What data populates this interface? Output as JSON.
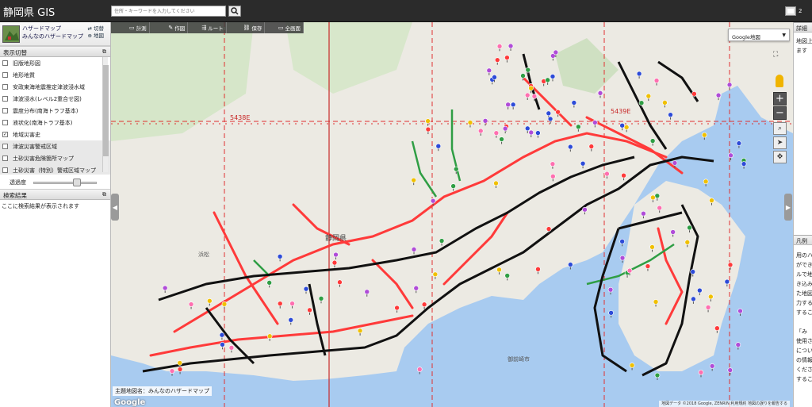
{
  "app": {
    "title": "静岡県 GIS"
  },
  "search": {
    "placeholder": "住所・キーワードを入力してください"
  },
  "topbar": {
    "page_indicator": "2"
  },
  "hazard_map": {
    "line1": "ハザードマップ",
    "line2": "みんなのハザードマップ",
    "switch_label_1": "⇄ 切替",
    "switch_label_2": "⊕ 地図"
  },
  "layers_panel": {
    "title": "表示切替",
    "items": [
      {
        "label": "旧版地形図",
        "checked": false,
        "shaded": false
      },
      {
        "label": "地形地質",
        "checked": false,
        "shaded": false
      },
      {
        "label": "安政東海地震推定津波浸水域",
        "checked": false,
        "shaded": false
      },
      {
        "label": "津波浸水(レベル2重合せ図)",
        "checked": false,
        "shaded": false
      },
      {
        "label": "震度分布(南海トラフ基本)",
        "checked": false,
        "shaded": false
      },
      {
        "label": "液状化(南海トラフ基本)",
        "checked": false,
        "shaded": false
      },
      {
        "label": "地域災害史",
        "checked": true,
        "shaded": false
      },
      {
        "label": "津波災害警戒区域",
        "checked": false,
        "shaded": true
      },
      {
        "label": "土砂災害危険箇所マップ",
        "checked": false,
        "shaded": true
      },
      {
        "label": "土砂災害（特別）警戒区域マップ",
        "checked": false,
        "shaded": true
      }
    ],
    "opacity_label": "透過度",
    "opacity_value": 0.72
  },
  "results_panel": {
    "title": "検索結果",
    "empty_text": "ここに検索結果が表示されます"
  },
  "map_toolbar": {
    "buttons": [
      {
        "label": "計測",
        "icon": "ruler-icon"
      },
      {
        "label": "作図",
        "icon": "pencil-icon"
      },
      {
        "label": "ルート",
        "icon": "route-icon"
      },
      {
        "label": "保存",
        "icon": "link-icon"
      },
      {
        "label": "全画面",
        "icon": "fullscreen-icon"
      }
    ]
  },
  "map": {
    "type_selected": "Google地図",
    "theme_label": "主題地図名：みんなのハザードマップ",
    "attribution": "地図データ ©2018 Google, ZENRIN  利用規約  地図の誤りを報告する",
    "prefecture_label": "静岡県",
    "grid_labels": [
      "5438E",
      "5439E"
    ],
    "place_labels": [
      "御前崎市",
      "浜松"
    ],
    "colors": {
      "sea": "#a8cbf0",
      "land": "#eceae3",
      "road_major": "#111111",
      "hazard_red": "#ff3a3a",
      "hazard_green": "#2f9e44",
      "grid_red": "#e03030"
    }
  },
  "right_panel": {
    "detail_title": "詳細",
    "detail_text": [
      "地図上",
      "ます"
    ],
    "legend_title": "凡例",
    "legend_text": [
      "用のハ",
      "ができ",
      "ルで地",
      "き込み",
      "た地図",
      "力する",
      "するこ",
      "",
      "「み",
      "使用さ",
      "につい",
      "の情報",
      "くださ",
      "すること"
    ]
  }
}
